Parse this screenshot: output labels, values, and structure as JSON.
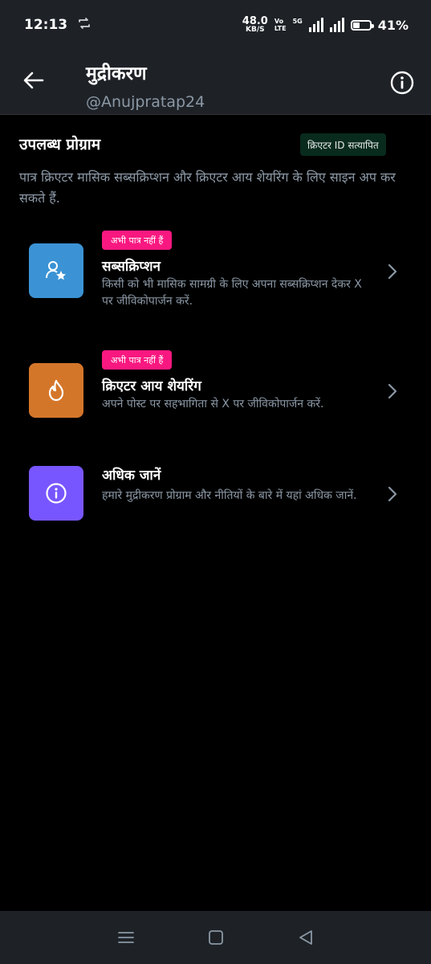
{
  "status_bar": {
    "time": "12:13",
    "sync_icon": "sync-arrows-icon",
    "net_speed_value": "48.0",
    "net_speed_unit": "KB/S",
    "volte": "Vo",
    "lte": "LTE",
    "network": "5G",
    "battery_percent": "41%",
    "battery_level": 0.41
  },
  "header": {
    "title": "मुद्रीकरण",
    "username": "@Anujpratap24"
  },
  "section": {
    "heading": "उपलब्ध प्रोग्राम",
    "verified_badge": "क्रिएटर ID सत्यापित",
    "description": "पात्र क्रिएटर मासिक सब्सक्रिप्शन और क्रिएटर आय शेयरिंग के लिए साइन अप कर सकते हैं."
  },
  "items": [
    {
      "badge": "अभी पात्र नहीं हैं",
      "title": "सब्सक्रिप्शन",
      "description": "किसी को भी मासिक सामग्री के लिए अपना सब्सक्रिप्शन देकर X पर जीविकोपार्जन करें.",
      "icon": "person-star-icon",
      "color": "#3b93d5"
    },
    {
      "badge": "अभी पात्र नहीं हैं",
      "title": "क्रिएटर आय शेयरिंग",
      "description": "अपने पोस्ट पर सहभागिता से X पर जीविकोपार्जन करें.",
      "icon": "flame-icon",
      "color": "#d4762a"
    },
    {
      "title": "अधिक जानें",
      "description": "हमारे मुद्रीकरण प्रोग्राम और नीतियों के बारे में यहां अधिक जानें.",
      "icon": "info-circle-icon",
      "color": "#7856ff"
    }
  ],
  "colors": {
    "background": "#000000",
    "bar": "#1e2227",
    "badge_pink": "#f91880",
    "verified_bg": "#092b1d",
    "muted_text": "#8b98a5"
  }
}
